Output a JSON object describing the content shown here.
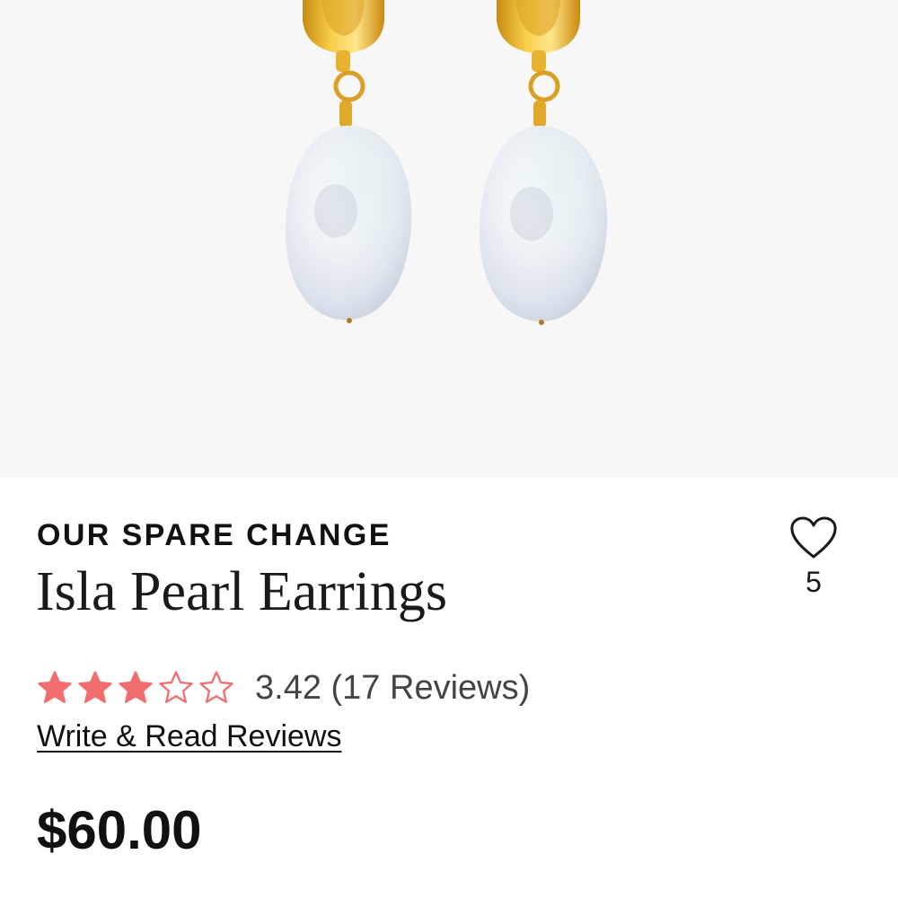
{
  "product": {
    "image_icon": "pearl-earrings-photo",
    "brand": "OUR SPARE CHANGE",
    "title": "Isla Pearl Earrings",
    "wishlist": {
      "icon": "heart-outline-icon",
      "count": "5"
    },
    "rating": {
      "value": 3.42,
      "max": 5,
      "text": "3.42 (17 Reviews)",
      "filled_stars": 3,
      "star_color": "#f26d6d"
    },
    "reviews_link": "Write & Read Reviews",
    "price": "$60.00"
  }
}
